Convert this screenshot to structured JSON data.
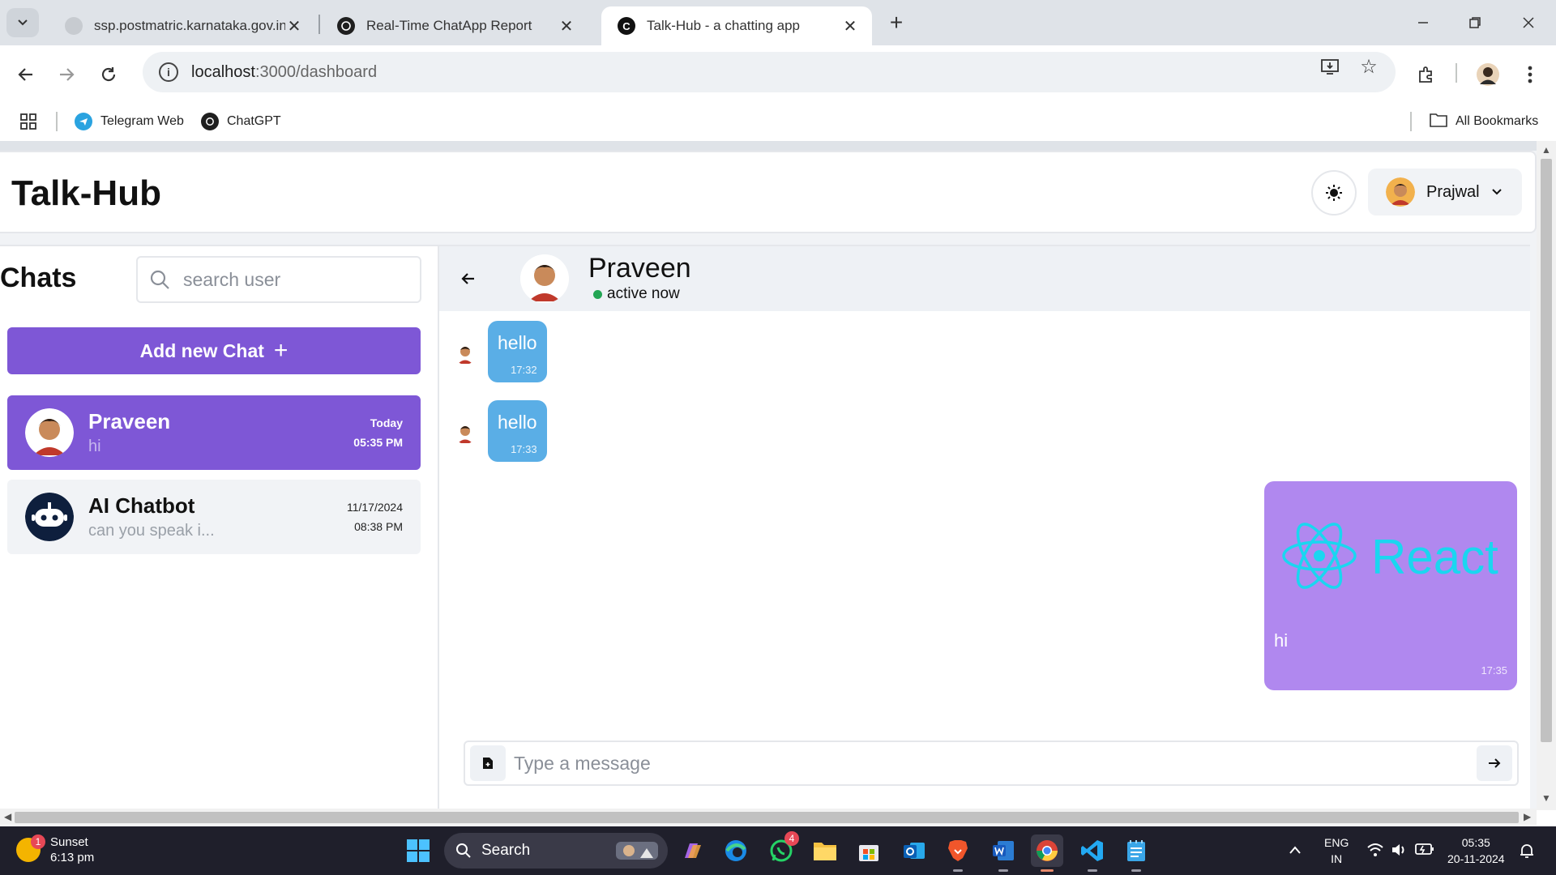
{
  "browser": {
    "tabs": [
      {
        "title": "ssp.postmatric.karnataka.gov.in",
        "active": false
      },
      {
        "title": "Real-Time ChatApp Report",
        "active": false
      },
      {
        "title": "Talk-Hub - a chatting app",
        "active": true
      }
    ],
    "url_host": "localhost",
    "url_path": ":3000/dashboard",
    "bookmarks": [
      {
        "label": "Telegram Web"
      },
      {
        "label": "ChatGPT"
      }
    ],
    "all_bookmarks_label": "All Bookmarks"
  },
  "app": {
    "brand": "Talk-Hub",
    "user": {
      "name": "Prajwal"
    },
    "sidebar": {
      "title": "Chats",
      "search_placeholder": "search user",
      "add_chat_label": "Add new Chat",
      "chats": [
        {
          "name": "Praveen",
          "preview": "hi",
          "date": "Today",
          "time": "05:35 PM",
          "active": true
        },
        {
          "name": "AI Chatbot",
          "preview": "can you speak i...",
          "date": "11/17/2024",
          "time": "08:38 PM",
          "active": false
        }
      ]
    },
    "conversation": {
      "contact_name": "Praveen",
      "status": "active now",
      "messages": [
        {
          "direction": "in",
          "text": "hello",
          "time": "17:32"
        },
        {
          "direction": "in",
          "text": "hello",
          "time": "17:33"
        },
        {
          "direction": "out",
          "text": "hi",
          "time": "17:35",
          "image_text": "React"
        }
      ],
      "composer_placeholder": "Type a message"
    },
    "colors": {
      "accent": "#7e57d6",
      "incoming_bubble": "#5aaee6",
      "outgoing_bubble": "#b088ef",
      "online": "#22a554",
      "react_cyan": "#1ad6f0"
    }
  },
  "taskbar": {
    "weather": {
      "label": "Sunset",
      "time": "6:13 pm",
      "badge": "1"
    },
    "search_label": "Search",
    "whatsapp_badge": "4",
    "lang_top": "ENG",
    "lang_bottom": "IN",
    "clock_time": "05:35",
    "clock_date": "20-11-2024"
  }
}
